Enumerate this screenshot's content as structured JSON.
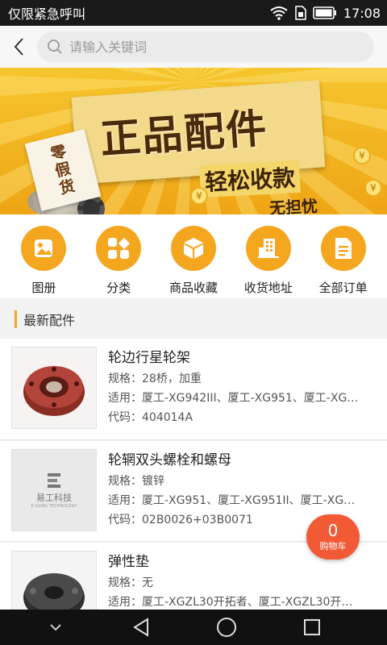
{
  "status_bar": {
    "carrier_text": "仅限紧急呼叫",
    "time": "17:08"
  },
  "header": {
    "back_icon": "chevron-left-icon",
    "search_placeholder": "请输入关键词",
    "search_value": ""
  },
  "banner": {
    "stamp_chars": [
      "零",
      "假",
      "货"
    ],
    "title": "正品配件",
    "subtitle": "轻松收款",
    "tagline": "无担忧",
    "coin_symbol": "¥"
  },
  "quick_nav": {
    "accent": "#f5a61f",
    "items": [
      {
        "label": "图册",
        "icon": "image-icon"
      },
      {
        "label": "分类",
        "icon": "category-grid-icon"
      },
      {
        "label": "商品收藏",
        "icon": "cube-box-icon"
      },
      {
        "label": "收货地址",
        "icon": "building-icon"
      },
      {
        "label": "全部订单",
        "icon": "document-icon"
      }
    ]
  },
  "section": {
    "title": "最新配件"
  },
  "products": [
    {
      "name": "轮边行星轮架",
      "spec": "规格：28桥，加重",
      "applies": "适用：厦工-XG942III、厦工-XG951、厦工-XG…",
      "code": "代码：404014A",
      "image": "planetary-carrier-image"
    },
    {
      "name": "轮辋双头螺栓和螺母",
      "spec": "规格：镀锌",
      "applies": "适用：厦工-XG951、厦工-XG951II、厦工-XG…",
      "code": "代码：02B0026+03B0071",
      "image": "brand-logo-placeholder",
      "logo_text": "易工科技",
      "logo_sub": "E-GONG TECHNOLOGY"
    },
    {
      "name": "弹性垫",
      "spec": "规格：无",
      "applies": "适用：厦工-XGZL30开拓者、厦工-XGZL30开…",
      "code": "",
      "image": "elastic-pad-image"
    }
  ],
  "cart": {
    "count": "0",
    "label": "购物车",
    "color": "#f25a35"
  },
  "system_nav": {
    "icons": [
      "chevron-down-icon",
      "back-triangle-icon",
      "home-circle-icon",
      "recents-square-icon"
    ]
  }
}
